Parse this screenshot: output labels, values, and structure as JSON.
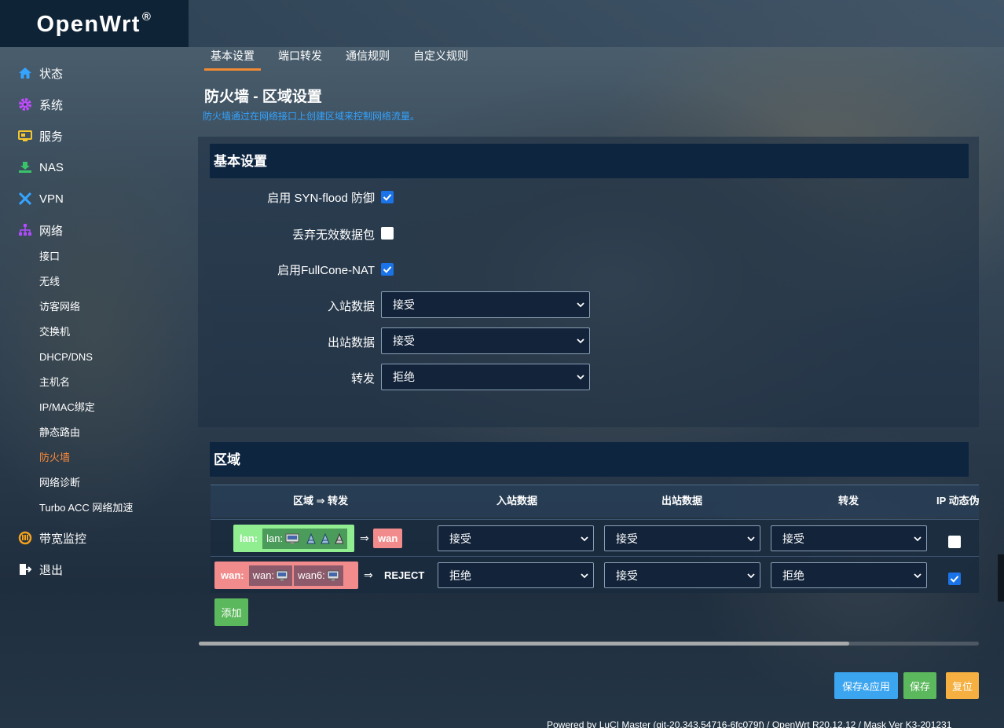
{
  "app": {
    "logo_text": "OpenWrt",
    "logo_mark": "®"
  },
  "sidebar": {
    "top_items": [
      {
        "label": "状态",
        "icon": "home-icon",
        "color": "#35a4ff"
      },
      {
        "label": "系统",
        "icon": "gear-icon",
        "color": "#c24bff"
      },
      {
        "label": "服务",
        "icon": "services-icon",
        "color": "#f4c62e"
      },
      {
        "label": "NAS",
        "icon": "nas-icon",
        "color": "#39c46a"
      },
      {
        "label": "VPN",
        "icon": "vpn-icon",
        "color": "#35a4ff"
      },
      {
        "label": "网络",
        "icon": "network-icon",
        "color": "#b14bff"
      }
    ],
    "sub_items": [
      {
        "label": "接口"
      },
      {
        "label": "无线"
      },
      {
        "label": "访客网络"
      },
      {
        "label": "交换机"
      },
      {
        "label": "DHCP/DNS"
      },
      {
        "label": "主机名"
      },
      {
        "label": "IP/MAC绑定"
      },
      {
        "label": "静态路由"
      },
      {
        "label": "防火墙",
        "active": true
      },
      {
        "label": "网络诊断"
      },
      {
        "label": "Turbo ACC 网络加速"
      }
    ],
    "bottom_items": [
      {
        "label": "带宽监控",
        "icon": "bandwidth-icon",
        "color": "#f4a21c"
      },
      {
        "label": "退出",
        "icon": "logout-icon",
        "color": "#ffffff"
      }
    ],
    "active_color": "#f7883a"
  },
  "tabs": [
    "基本设置",
    "端口转发",
    "通信规则",
    "自定义规则"
  ],
  "page": {
    "title": "防火墙 - 区域设置",
    "description": "防火墙通过在网络接口上创建区域来控制网络流量。"
  },
  "basic": {
    "title": "基本设置",
    "syn_flood": {
      "label": "启用 SYN-flood 防御",
      "checked": true
    },
    "drop_invalid": {
      "label": "丢弃无效数据包",
      "checked": false
    },
    "fullcone": {
      "label": "启用FullCone-NAT",
      "checked": true
    },
    "input": {
      "label": "入站数据",
      "value": "接受"
    },
    "output": {
      "label": "出站数据",
      "value": "接受"
    },
    "forward": {
      "label": "转发",
      "value": "拒绝"
    }
  },
  "zones": {
    "title": "区域",
    "headers": {
      "zone": "区域 ⇒ 转发",
      "input": "入站数据",
      "output": "出站数据",
      "forward": "转发",
      "masq": "IP 动态伪"
    },
    "rows": [
      {
        "zone": "lan:",
        "interfaces": [
          {
            "name": "lan:",
            "icons": [
              "ethernet-icon",
              "wireless-icon",
              "wireless-icon",
              "wireless-icon"
            ]
          }
        ],
        "arrow": "⇒",
        "dest": "wan",
        "input": "接受",
        "output": "接受",
        "forward": "接受",
        "masq": false,
        "color": "#90ee90"
      },
      {
        "zone": "wan:",
        "interfaces": [
          {
            "name": "wan:",
            "icons": [
              "ethernet-icon"
            ]
          },
          {
            "name": "wan6:",
            "icons": [
              "ethernet-icon"
            ]
          }
        ],
        "arrow": "⇒",
        "dest": "REJECT",
        "input": "拒绝",
        "output": "接受",
        "forward": "拒绝",
        "masq": true,
        "color": "#f28b8b"
      }
    ],
    "add_label": "添加"
  },
  "actions": {
    "save_apply": "保存&应用",
    "save": "保存",
    "reset": "复位"
  },
  "footer": "Powered by LuCI Master (git-20.343.54716-6fc079f) / OpenWrt R20.12.12 / Mask Ver K3-201231"
}
